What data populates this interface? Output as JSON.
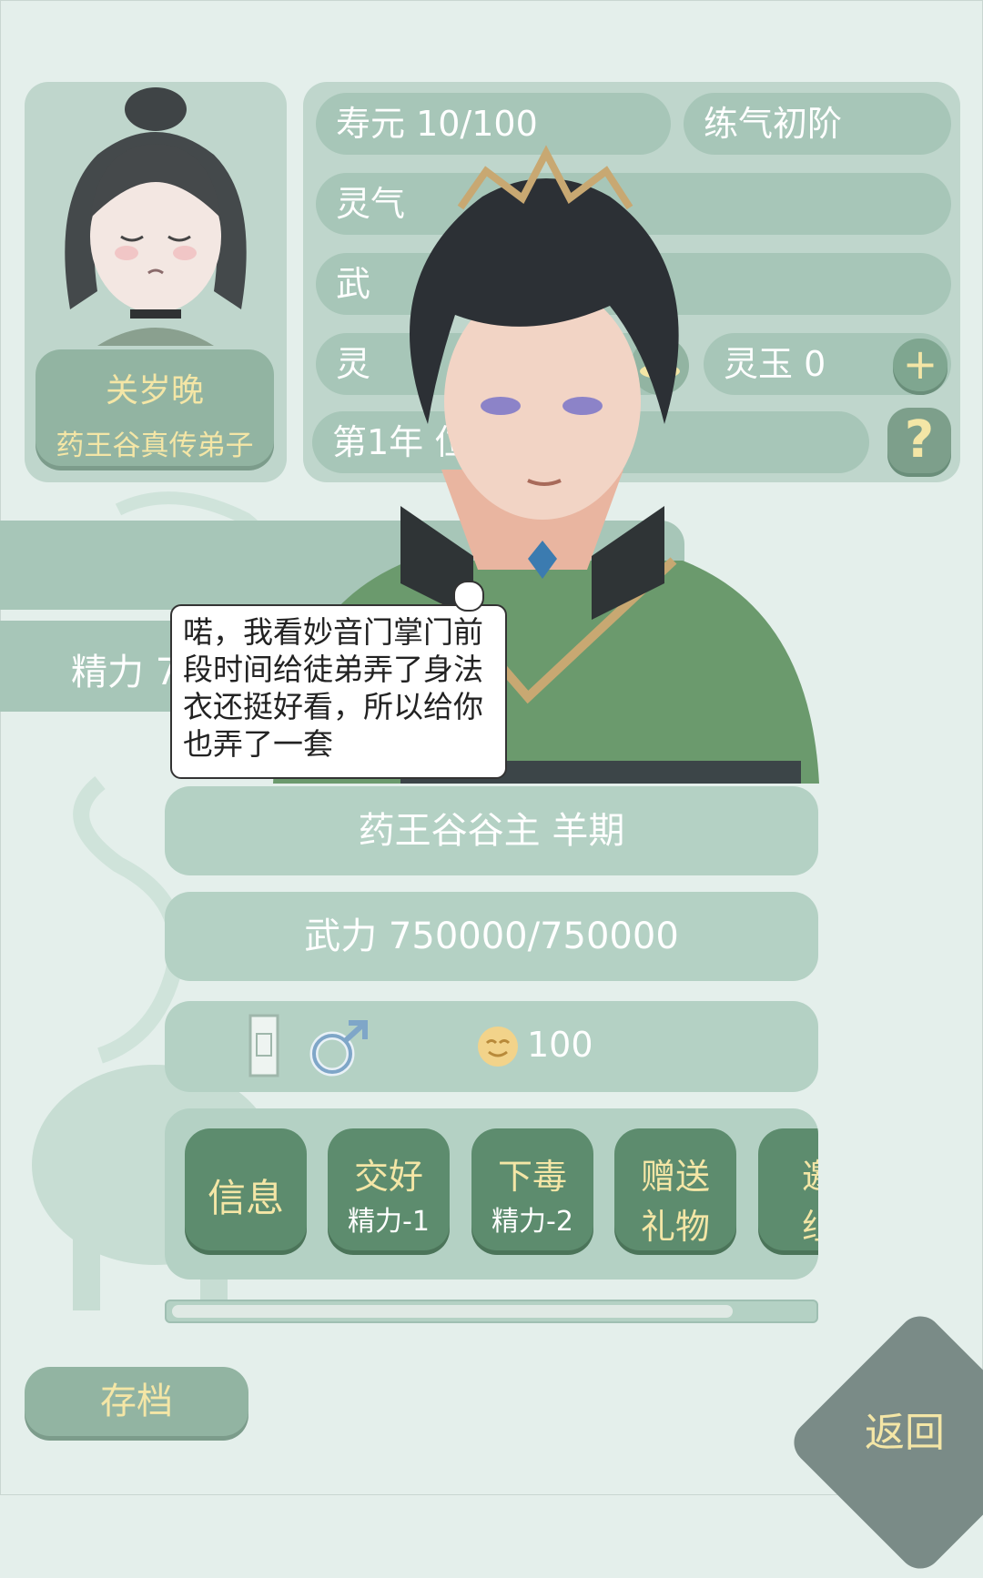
{
  "player": {
    "name": "关岁晚",
    "title": "药王谷真传弟子",
    "lifespan": "寿元 10/100",
    "realm": "练气初阶",
    "spirit_label": "灵气",
    "row3_label": "武",
    "row4_label": "灵",
    "jade": "灵玉 0",
    "location": "第1年 位于药王谷",
    "energy": "精力 7"
  },
  "dialogue": "喏，我看妙音门掌门前段时间给徒弟弄了身法衣还挺好看，所以给你也弄了一套",
  "npc": {
    "name": "药王谷谷主 羊期",
    "power": "武力 750000/750000",
    "favor": "100"
  },
  "actions": [
    {
      "line1": "信息",
      "line2": ""
    },
    {
      "line1": "交好",
      "line2": "精力-1"
    },
    {
      "line1": "下毒",
      "line2": "精力-2"
    },
    {
      "line1": "赠送",
      "line2": "礼物"
    },
    {
      "line1": "邀",
      "line2": "组"
    }
  ],
  "scroll_progress": 0.88,
  "buttons": {
    "save": "存档",
    "back": "返回",
    "plus": "+",
    "help": "?"
  },
  "colors": {
    "accent_gold": "#f4e6a6",
    "button_green": "#5d8c6e",
    "panel": "#bfd6cc"
  }
}
